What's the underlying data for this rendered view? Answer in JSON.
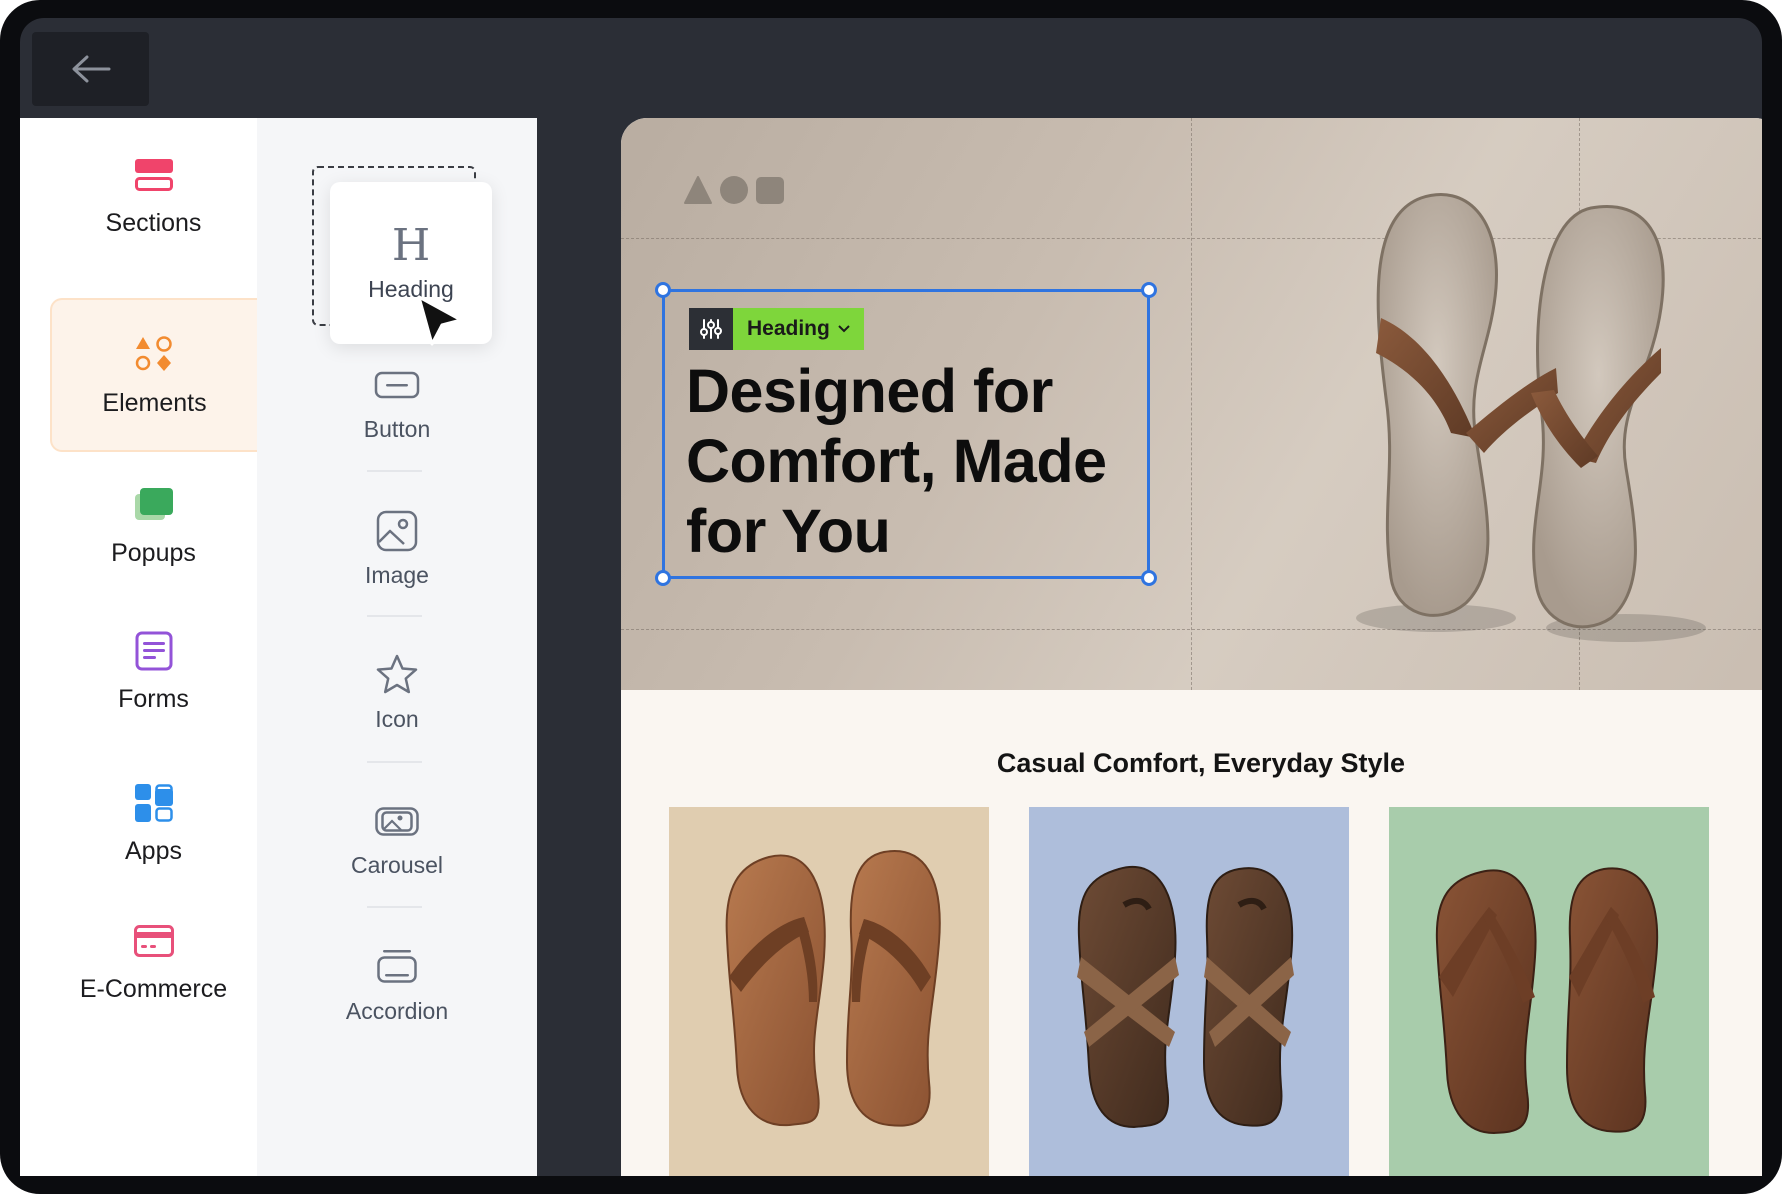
{
  "sidebar": {
    "items": [
      {
        "label": "Sections",
        "icon": "sections-icon",
        "active": false
      },
      {
        "label": "Elements",
        "icon": "elements-icon",
        "active": true
      },
      {
        "label": "Popups",
        "icon": "popups-icon",
        "active": false
      },
      {
        "label": "Forms",
        "icon": "forms-icon",
        "active": false
      },
      {
        "label": "Apps",
        "icon": "apps-icon",
        "active": false
      },
      {
        "label": "E-Commerce",
        "icon": "ecommerce-icon",
        "active": false
      }
    ]
  },
  "palette": {
    "items": [
      {
        "label": "Heading",
        "icon": "heading-icon",
        "dragging": true
      },
      {
        "label": "Button",
        "icon": "button-icon"
      },
      {
        "label": "Image",
        "icon": "image-icon"
      },
      {
        "label": "Icon",
        "icon": "star-icon"
      },
      {
        "label": "Carousel",
        "icon": "carousel-icon"
      },
      {
        "label": "Accordion",
        "icon": "accordion-icon"
      }
    ],
    "heading_glyph": "H"
  },
  "canvas": {
    "selection_label": "Heading",
    "hero_heading": "Designed for Comfort, Made for You",
    "section_title": "Casual Comfort, Everyday Style",
    "cards": [
      {
        "bg": "#e0cdb0",
        "product": "flip-flop"
      },
      {
        "bg": "#aebedb",
        "product": "cross-strap-sandal"
      },
      {
        "bg": "#a8ccab",
        "product": "toe-post-sandal"
      }
    ]
  },
  "colors": {
    "selection": "#2f74e0",
    "label_green": "#7ed63b",
    "active_rail_bg": "#fdf3ea"
  }
}
